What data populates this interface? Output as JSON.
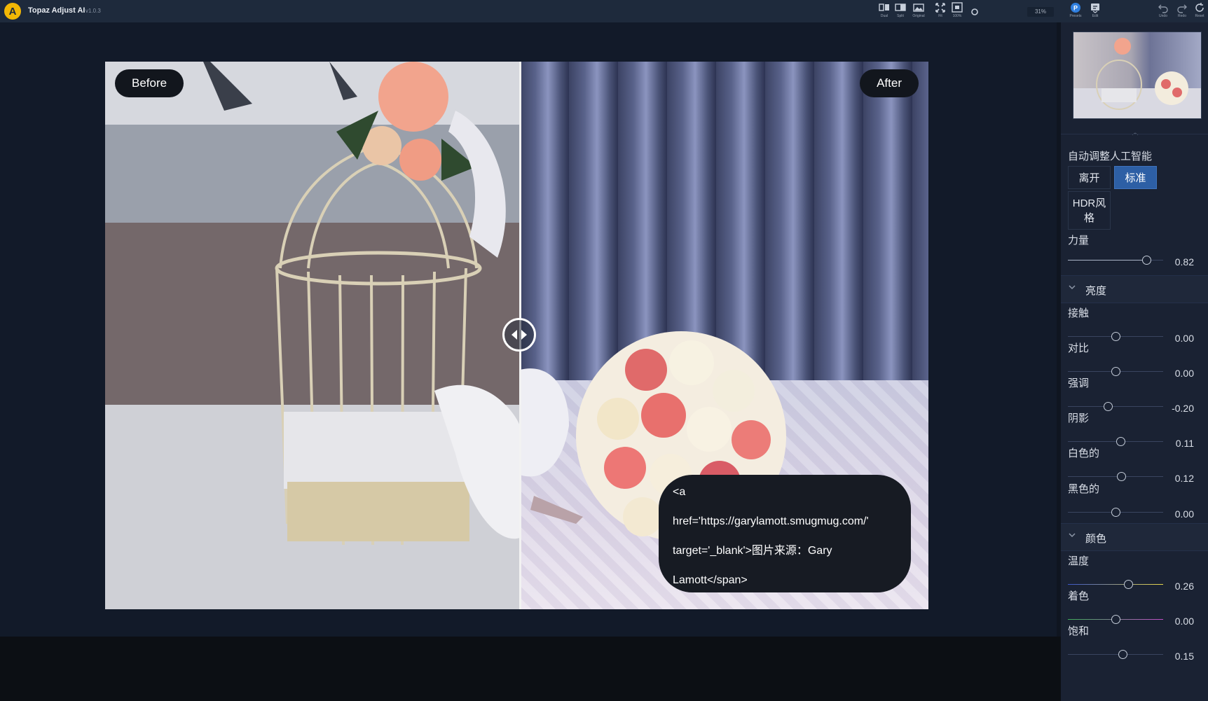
{
  "app": {
    "name": "Topaz Adjust AI",
    "version": "v1.0.3",
    "logo_letter": "A"
  },
  "toolbar": {
    "view_buttons": [
      {
        "label": "Dual",
        "icon": "dual-view-icon"
      },
      {
        "label": "Split",
        "icon": "split-view-icon"
      },
      {
        "label": "Original",
        "icon": "original-view-icon"
      },
      {
        "label": "Fit",
        "icon": "fit-icon"
      },
      {
        "label": "100%",
        "icon": "actual-size-icon"
      }
    ],
    "zoom": "31%",
    "right_buttons": [
      {
        "label": "Presets",
        "icon": "presets-icon"
      },
      {
        "label": "Edit",
        "icon": "edit-icon"
      },
      {
        "label": "Undo",
        "icon": "undo-icon"
      },
      {
        "label": "Redo",
        "icon": "redo-icon"
      },
      {
        "label": "Reset",
        "icon": "reset-icon"
      }
    ]
  },
  "preview": {
    "before_label": "Before",
    "after_label": "After",
    "tooltip": "<a\nhref='https://garylamott.smugmug.com/'\ntarget='_blank'>图片来源：Gary\nLamott</span>"
  },
  "panel": {
    "ai_title": "自动调整人工智能",
    "modes": {
      "off": "离开",
      "standard": "标准",
      "hdr": "HDR风格"
    },
    "strength": {
      "label": "力量",
      "value": "0.82",
      "fraction": 0.82
    },
    "brightness_section": "亮度",
    "brightness_sliders": [
      {
        "label": "接触",
        "value": "0.00",
        "fraction": 0.5
      },
      {
        "label": "对比",
        "value": "0.00",
        "fraction": 0.5
      },
      {
        "label": "强调",
        "value": "-0.20",
        "fraction": 0.42
      },
      {
        "label": "阴影",
        "value": "0.11",
        "fraction": 0.55
      },
      {
        "label": "白色的",
        "value": "0.12",
        "fraction": 0.56
      },
      {
        "label": "黑色的",
        "value": "0.00",
        "fraction": 0.5
      }
    ],
    "color_section": "颜色",
    "color_sliders": [
      {
        "label": "温度",
        "value": "0.26",
        "fraction": 0.63
      },
      {
        "label": "着色",
        "value": "0.00",
        "fraction": 0.5
      },
      {
        "label": "饱和",
        "value": "0.15",
        "fraction": 0.57
      }
    ]
  },
  "colors": {
    "accent": "#2d5fa5",
    "titlebar": "#1e2a3c",
    "panel": "#1a2233",
    "logo": "#f2b705"
  }
}
